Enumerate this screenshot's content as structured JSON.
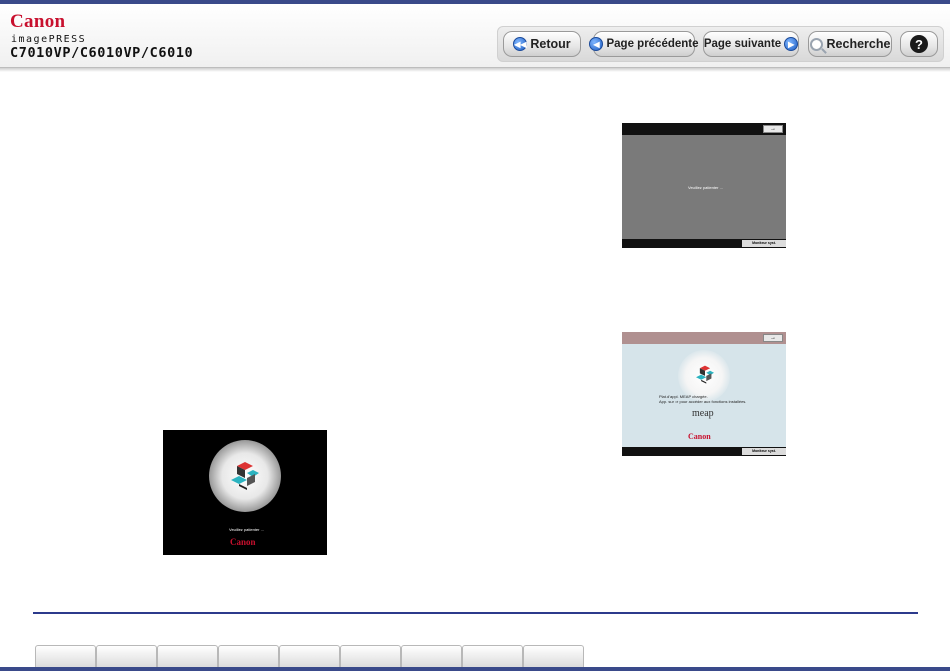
{
  "header": {
    "brand": "Canon",
    "product_line": "imagePRESS",
    "model": "C7010VP/C6010VP/C6010"
  },
  "nav": {
    "back_label": "Retour",
    "prev_label": "Page précédente",
    "next_label": "Page suivante",
    "search_label": "Recherche",
    "help_label": "?"
  },
  "screens": {
    "startup": {
      "message": "Veuillez patienter ...",
      "logo": "Canon"
    },
    "waiting": {
      "arrow": "→",
      "message": "Veuillez patienter ...",
      "status_button": "Moniteur syst."
    },
    "meap": {
      "arrow": "→",
      "message_line1": "Plat.d'appl. MEAP chargée.",
      "message_line2": "App. sur ⇒ pour accéder aux fonctions installées.",
      "meap_logo": "meap",
      "logo": "Canon",
      "status_button": "Moniteur syst."
    }
  },
  "footer": {
    "tab_count": 9
  },
  "colors": {
    "accent_bar": "#3a4a8a",
    "brand_red": "#c8102e",
    "nav_icon_blue": "#1f5fc4"
  }
}
